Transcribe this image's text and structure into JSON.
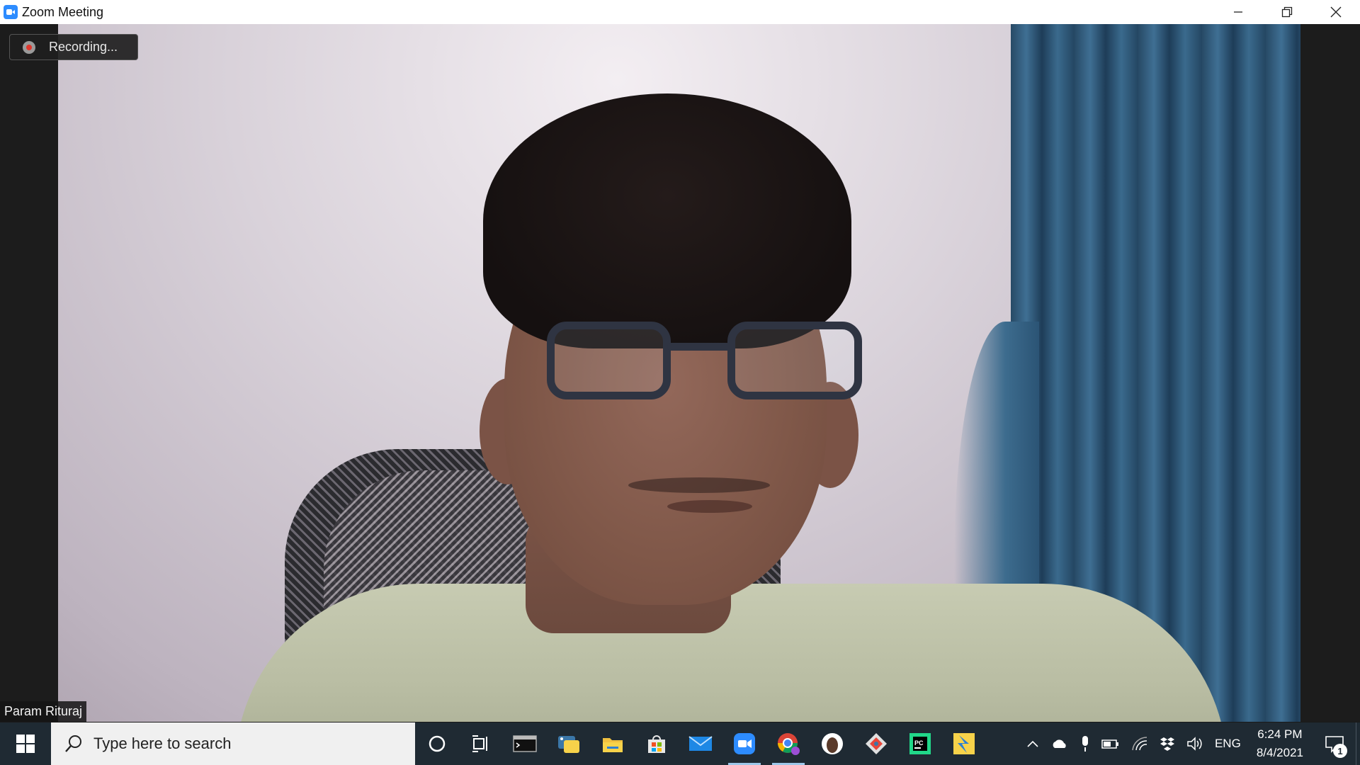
{
  "window": {
    "title": "Zoom Meeting",
    "app_icon": "zoom-icon",
    "controls": [
      "minimize-icon",
      "restore-icon",
      "close-icon"
    ]
  },
  "meeting": {
    "recording_label": "Recording...",
    "participant_name": "Param Rituraj"
  },
  "taskbar": {
    "search_placeholder": "Type here to search",
    "pinned_apps": [
      {
        "name": "cortana-icon"
      },
      {
        "name": "task-view-icon"
      },
      {
        "name": "terminal-icon"
      },
      {
        "name": "python-icon"
      },
      {
        "name": "file-explorer-icon"
      },
      {
        "name": "microsoft-store-icon"
      },
      {
        "name": "mail-icon"
      },
      {
        "name": "zoom-icon",
        "active": true
      },
      {
        "name": "chrome-icon",
        "active": true
      },
      {
        "name": "inkscape-icon"
      },
      {
        "name": "git-icon"
      },
      {
        "name": "pycharm-icon"
      },
      {
        "name": "jupyter-icon"
      }
    ],
    "tray": {
      "icons": [
        "chevron-up-icon",
        "onedrive-icon",
        "microphone-icon",
        "battery-icon",
        "wifi-icon",
        "dropbox-icon",
        "volume-icon"
      ],
      "language": "ENG",
      "time": "6:24 PM",
      "date": "8/4/2021",
      "notification_count": "1"
    }
  }
}
